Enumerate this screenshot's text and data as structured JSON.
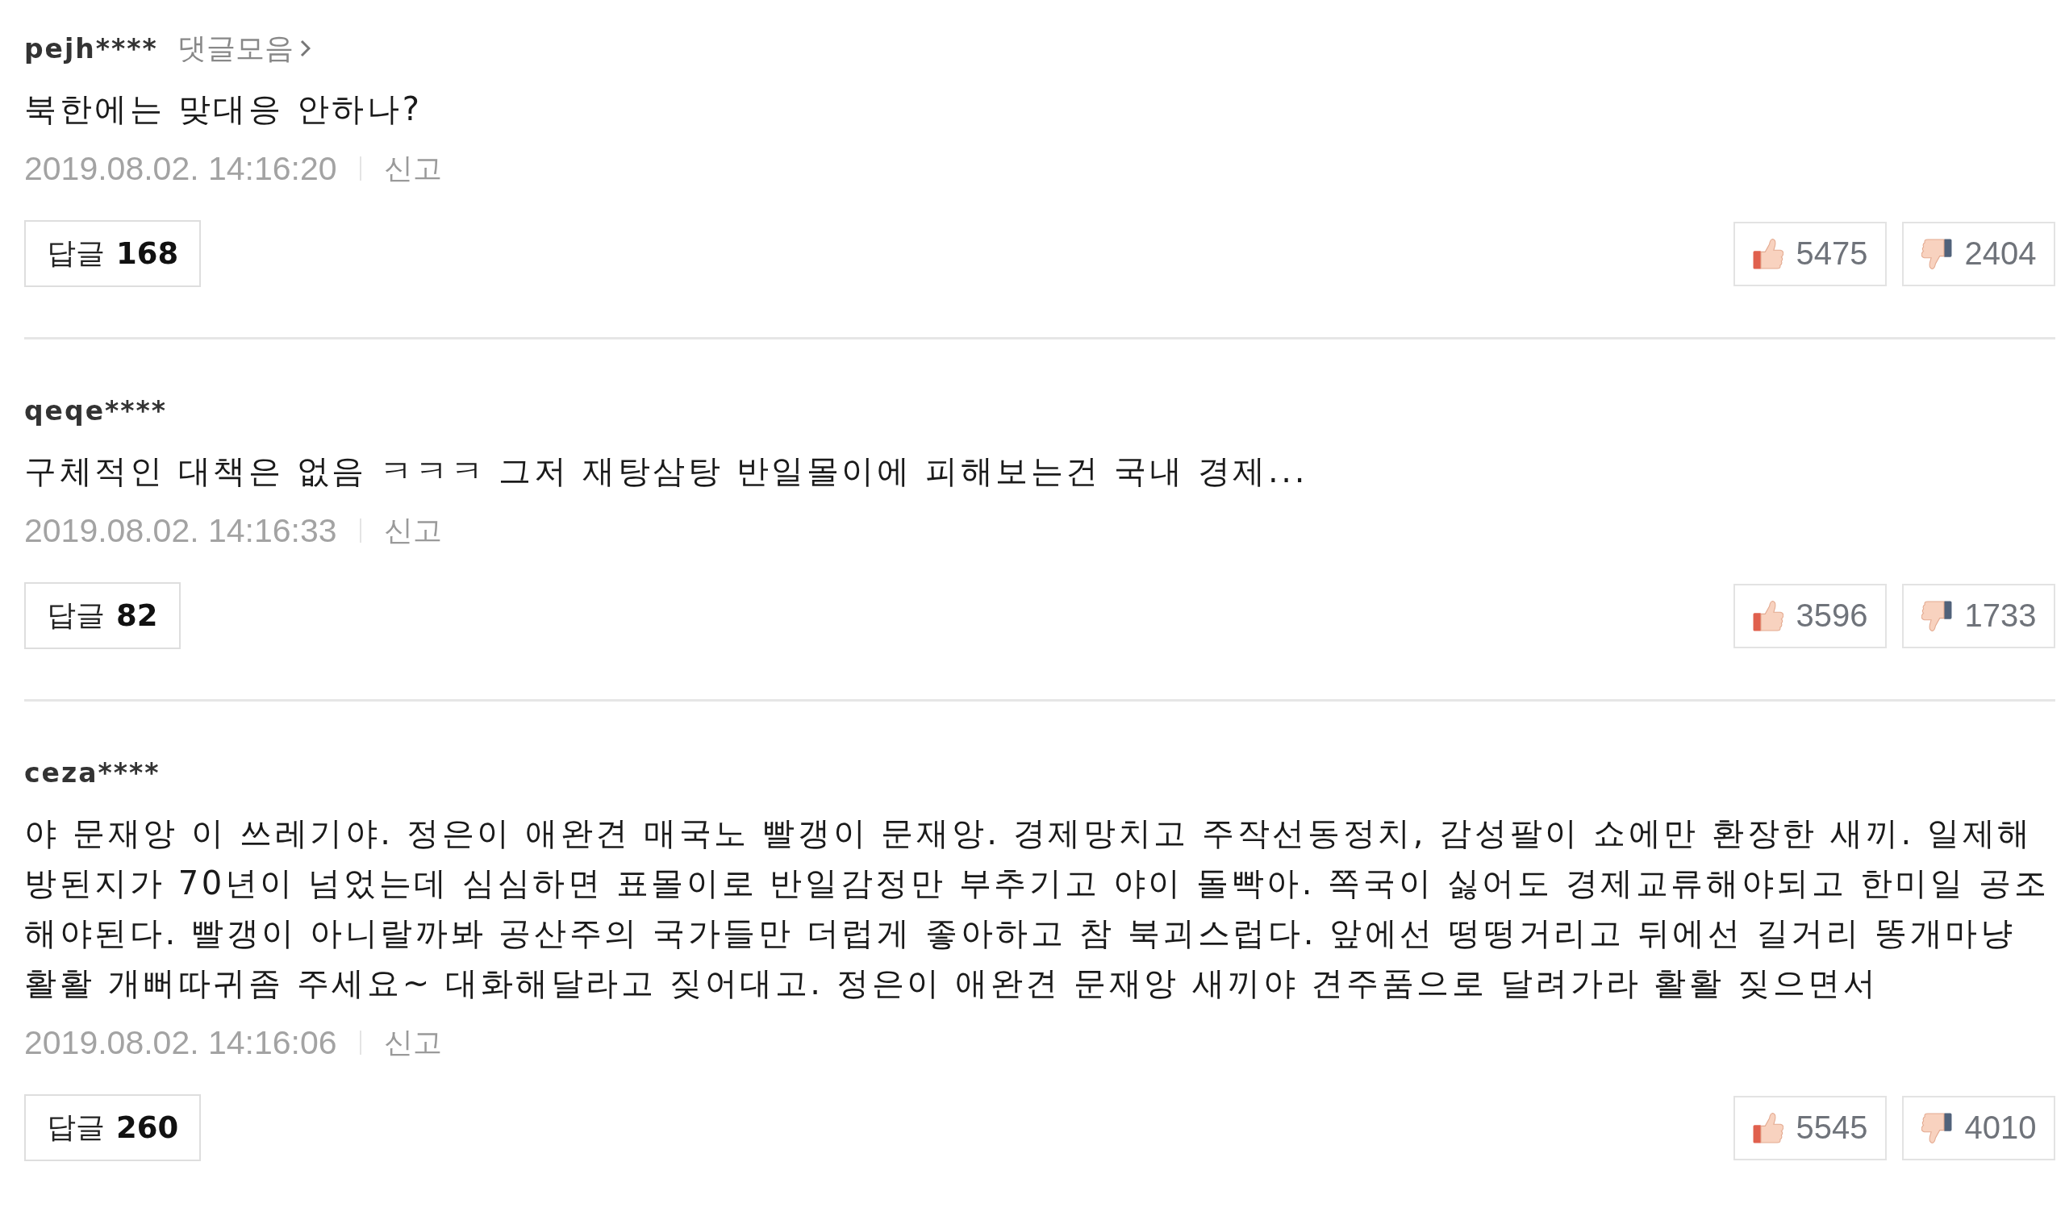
{
  "comments": [
    {
      "author": "pejh****",
      "history_link": "댓글모음",
      "text": "북한에는 맞대응 안하나?",
      "date": "2019.08.02. 14:16:20",
      "report": "신고",
      "reply_label": "답글",
      "reply_count": "168",
      "likes": "5475",
      "dislikes": "2404"
    },
    {
      "author": "qeqe****",
      "text": "구체적인 대책은 없음 ㅋㅋㅋ 그저 재탕삼탕 반일몰이에 피해보는건 국내 경제...",
      "date": "2019.08.02. 14:16:33",
      "report": "신고",
      "reply_label": "답글",
      "reply_count": "82",
      "likes": "3596",
      "dislikes": "1733"
    },
    {
      "author": "ceza****",
      "text": "야 문재앙 이 쓰레기야. 정은이 애완견 매국노 빨갱이 문재앙. 경제망치고 주작선동정치, 감성팔이 쇼에만 환장한 새끼. 일제해방된지가 70년이 넘었는데 심심하면 표몰이로 반일감정만 부추기고 야이 돌빡아. 쪽국이 싫어도 경제교류해야되고 한미일 공조해야된다. 빨갱이 아니랄까봐 공산주의 국가들만 더럽게 좋아하고 참 북괴스럽다. 앞에선 떵떵거리고 뒤에선 길거리 똥개마냥 활활 개뻐따귀좀 주세요~ 대화해달라고 짖어대고. 정은이 애완견 문재앙 새끼야 견주품으로 달려가라 활활 짖으면서",
      "date": "2019.08.02. 14:16:06",
      "report": "신고",
      "reply_label": "답글",
      "reply_count": "260",
      "likes": "5545",
      "dislikes": "4010"
    }
  ]
}
